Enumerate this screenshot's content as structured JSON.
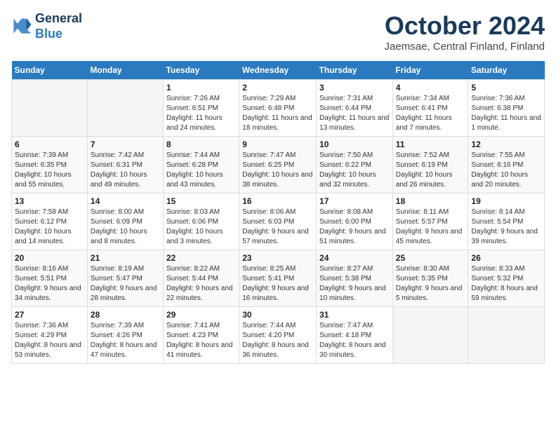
{
  "header": {
    "logo_line1": "General",
    "logo_line2": "Blue",
    "month": "October 2024",
    "location": "Jaemsae, Central Finland, Finland"
  },
  "weekdays": [
    "Sunday",
    "Monday",
    "Tuesday",
    "Wednesday",
    "Thursday",
    "Friday",
    "Saturday"
  ],
  "weeks": [
    [
      {
        "day": "",
        "info": ""
      },
      {
        "day": "",
        "info": ""
      },
      {
        "day": "1",
        "info": "Sunrise: 7:26 AM\nSunset: 6:51 PM\nDaylight: 11 hours and 24 minutes."
      },
      {
        "day": "2",
        "info": "Sunrise: 7:29 AM\nSunset: 6:48 PM\nDaylight: 11 hours and 18 minutes."
      },
      {
        "day": "3",
        "info": "Sunrise: 7:31 AM\nSunset: 6:44 PM\nDaylight: 11 hours and 13 minutes."
      },
      {
        "day": "4",
        "info": "Sunrise: 7:34 AM\nSunset: 6:41 PM\nDaylight: 11 hours and 7 minutes."
      },
      {
        "day": "5",
        "info": "Sunrise: 7:36 AM\nSunset: 6:38 PM\nDaylight: 11 hours and 1 minute."
      }
    ],
    [
      {
        "day": "6",
        "info": "Sunrise: 7:39 AM\nSunset: 6:35 PM\nDaylight: 10 hours and 55 minutes."
      },
      {
        "day": "7",
        "info": "Sunrise: 7:42 AM\nSunset: 6:31 PM\nDaylight: 10 hours and 49 minutes."
      },
      {
        "day": "8",
        "info": "Sunrise: 7:44 AM\nSunset: 6:28 PM\nDaylight: 10 hours and 43 minutes."
      },
      {
        "day": "9",
        "info": "Sunrise: 7:47 AM\nSunset: 6:25 PM\nDaylight: 10 hours and 38 minutes."
      },
      {
        "day": "10",
        "info": "Sunrise: 7:50 AM\nSunset: 6:22 PM\nDaylight: 10 hours and 32 minutes."
      },
      {
        "day": "11",
        "info": "Sunrise: 7:52 AM\nSunset: 6:19 PM\nDaylight: 10 hours and 26 minutes."
      },
      {
        "day": "12",
        "info": "Sunrise: 7:55 AM\nSunset: 6:16 PM\nDaylight: 10 hours and 20 minutes."
      }
    ],
    [
      {
        "day": "13",
        "info": "Sunrise: 7:58 AM\nSunset: 6:12 PM\nDaylight: 10 hours and 14 minutes."
      },
      {
        "day": "14",
        "info": "Sunrise: 8:00 AM\nSunset: 6:09 PM\nDaylight: 10 hours and 8 minutes."
      },
      {
        "day": "15",
        "info": "Sunrise: 8:03 AM\nSunset: 6:06 PM\nDaylight: 10 hours and 3 minutes."
      },
      {
        "day": "16",
        "info": "Sunrise: 8:06 AM\nSunset: 6:03 PM\nDaylight: 9 hours and 57 minutes."
      },
      {
        "day": "17",
        "info": "Sunrise: 8:08 AM\nSunset: 6:00 PM\nDaylight: 9 hours and 51 minutes."
      },
      {
        "day": "18",
        "info": "Sunrise: 8:11 AM\nSunset: 5:57 PM\nDaylight: 9 hours and 45 minutes."
      },
      {
        "day": "19",
        "info": "Sunrise: 8:14 AM\nSunset: 5:54 PM\nDaylight: 9 hours and 39 minutes."
      }
    ],
    [
      {
        "day": "20",
        "info": "Sunrise: 8:16 AM\nSunset: 5:51 PM\nDaylight: 9 hours and 34 minutes."
      },
      {
        "day": "21",
        "info": "Sunrise: 8:19 AM\nSunset: 5:47 PM\nDaylight: 9 hours and 28 minutes."
      },
      {
        "day": "22",
        "info": "Sunrise: 8:22 AM\nSunset: 5:44 PM\nDaylight: 9 hours and 22 minutes."
      },
      {
        "day": "23",
        "info": "Sunrise: 8:25 AM\nSunset: 5:41 PM\nDaylight: 9 hours and 16 minutes."
      },
      {
        "day": "24",
        "info": "Sunrise: 8:27 AM\nSunset: 5:38 PM\nDaylight: 9 hours and 10 minutes."
      },
      {
        "day": "25",
        "info": "Sunrise: 8:30 AM\nSunset: 5:35 PM\nDaylight: 9 hours and 5 minutes."
      },
      {
        "day": "26",
        "info": "Sunrise: 8:33 AM\nSunset: 5:32 PM\nDaylight: 8 hours and 59 minutes."
      }
    ],
    [
      {
        "day": "27",
        "info": "Sunrise: 7:36 AM\nSunset: 4:29 PM\nDaylight: 8 hours and 53 minutes."
      },
      {
        "day": "28",
        "info": "Sunrise: 7:39 AM\nSunset: 4:26 PM\nDaylight: 8 hours and 47 minutes."
      },
      {
        "day": "29",
        "info": "Sunrise: 7:41 AM\nSunset: 4:23 PM\nDaylight: 8 hours and 41 minutes."
      },
      {
        "day": "30",
        "info": "Sunrise: 7:44 AM\nSunset: 4:20 PM\nDaylight: 8 hours and 36 minutes."
      },
      {
        "day": "31",
        "info": "Sunrise: 7:47 AM\nSunset: 4:18 PM\nDaylight: 8 hours and 30 minutes."
      },
      {
        "day": "",
        "info": ""
      },
      {
        "day": "",
        "info": ""
      }
    ]
  ]
}
